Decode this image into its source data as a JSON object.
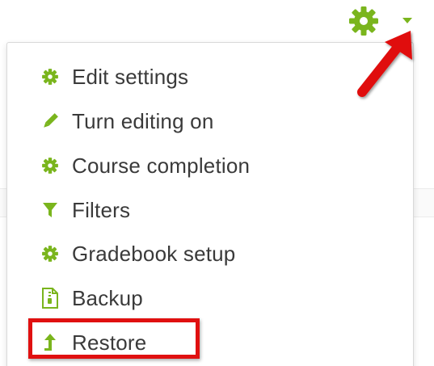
{
  "toolbar": {
    "settings_icon": "gear-icon",
    "dropdown_icon": "caret-down-icon"
  },
  "menu": {
    "items": [
      {
        "label": "Edit settings",
        "icon": "gear-icon"
      },
      {
        "label": "Turn editing on",
        "icon": "pencil-icon"
      },
      {
        "label": "Course completion",
        "icon": "gear-icon"
      },
      {
        "label": "Filters",
        "icon": "filter-icon"
      },
      {
        "label": "Gradebook setup",
        "icon": "gear-icon"
      },
      {
        "label": "Backup",
        "icon": "backup-file-icon",
        "highlighted": true
      },
      {
        "label": "Restore",
        "icon": "upload-arrow-icon"
      }
    ]
  },
  "colors": {
    "icon_green": "#7ab51d",
    "highlight_red": "#e01010",
    "text": "#3a3a3a"
  }
}
